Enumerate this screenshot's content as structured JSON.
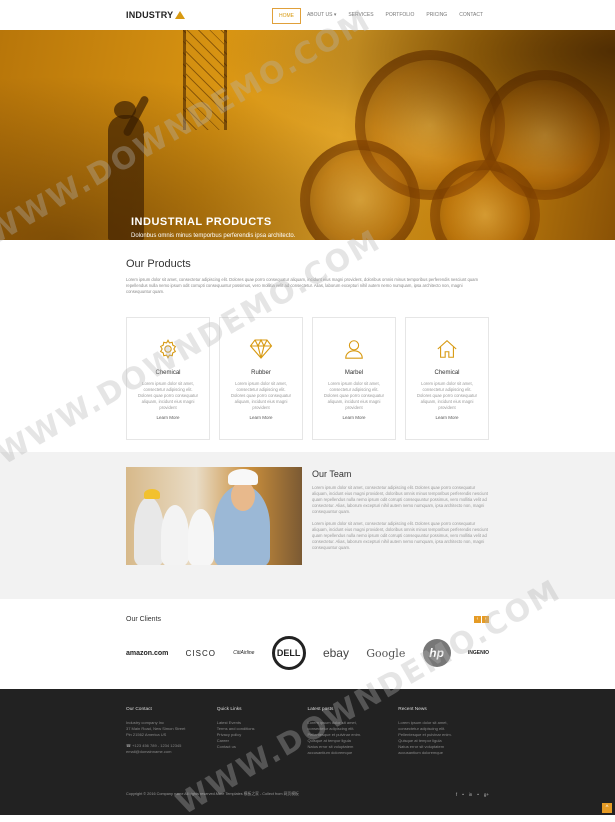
{
  "header": {
    "logo": "INDUSTRY",
    "nav": [
      {
        "label": "HOME",
        "active": true
      },
      {
        "label": "ABOUT US ▾",
        "active": false
      },
      {
        "label": "SERVICES",
        "active": false
      },
      {
        "label": "PORTFOLIO",
        "active": false
      },
      {
        "label": "PRICING",
        "active": false
      },
      {
        "label": "CONTACT",
        "active": false
      }
    ]
  },
  "hero": {
    "title": "INDUSTRIAL PRODUCTS",
    "subtitle": "Dolonbus omnis minus temporbus perferendis ipsa architecto."
  },
  "products": {
    "title": "Our Products",
    "lead": "Lorem ipsum dolor sit amet, consectetur adipiscing elit. Dolores quae porro consequatur aliquam, incidunt eius magni provident, doloribus omnis minus temporibus perferendis nesciunt quam repellendus nulla nemo ipsum odit corrupti consequuntur possimus, vero mollitia velit ad consectetur. Alias, laborum excepturi nihil autem nemo numquam, ipsa architecto non, magni consequuntur quam.",
    "cards": [
      {
        "icon": "gear-icon",
        "title": "Chemical",
        "text": "Lorem ipsum dolor sit amet, consectetur adipiscing elit. Dolores quae porro consequatur aliquam, incidunt eius magni provident",
        "link": "Learn More"
      },
      {
        "icon": "diamond-icon",
        "title": "Rubber",
        "text": "Lorem ipsum dolor sit amet, consectetur adipiscing elit. Dolores quae porro consequatur aliquam, incidunt eius magni provident",
        "link": "Learn More"
      },
      {
        "icon": "user-icon",
        "title": "Marbel",
        "text": "Lorem ipsum dolor sit amet, consectetur adipiscing elit. Dolores quae porro consequatur aliquam, incidunt eius magni provident",
        "link": "Learn More"
      },
      {
        "icon": "home-icon",
        "title": "Chemical",
        "text": "Lorem ipsum dolor sit amet, consectetur adipiscing elit. Dolores quae porro consequatur aliquam, incidunt eius magni provident",
        "link": "Learn More"
      }
    ]
  },
  "team": {
    "title": "Our Team",
    "p1": "Lorem ipsum dolor sit amet, consectetur adipiscing elit. Dolores quae porro consequatur aliquam, incidunt eius magni provident, doloribus omnis minus temporibus perferendis nesciunt quam repellendus nulla nemo ipsum odit corrupti consequuntur possimus, vero mollitia velit ad consectetur. Alias, laborum excepturi nihil autem nemo numquam, ipsa architecto non, magni consequuntur quam.",
    "p2": "Lorem ipsum dolor sit amet, consectetur adipiscing elit. Dolores quae porro consequatur aliquam, incidunt eius magni provident, doloribus omnis minus temporibus perferendis nesciunt quam repellendus nulla nemo ipsum odit corrupti consequuntur possimus, vero mollitia velit ad consectetur. Alias, laborum excepturi nihil autem nemo numquam, ipsa architecto non, magni consequuntur quam."
  },
  "clients": {
    "title": "Our Clients",
    "logos": [
      "amazon.com",
      "CISCO",
      "CitiAirline",
      "DELL",
      "ebay",
      "Google",
      "hp",
      "INGENIO"
    ]
  },
  "footer": {
    "contact": {
      "heading": "Our Contact",
      "lines": [
        "Industry company Inc",
        "37 Main Road, New Simon Street",
        "Pin 21562 America US",
        "",
        "☎ +123 456 789 - 1234 12345",
        "email@domainname.com"
      ]
    },
    "quick_links": {
      "heading": "Quick Links",
      "items": [
        "Latest Events",
        "Terms and conditions",
        "Privacy policy",
        "Career",
        "Contact us"
      ]
    },
    "latest_posts": {
      "heading": "Latest posts",
      "items": [
        "Lorem ipsum dolor sit amet,",
        "consectetur adipiscing elit.",
        "Pellentesque et pulvinar enim.",
        "Quisque at tempor ligula",
        "Natus error sit voluptatem",
        "accusantium doloremque"
      ]
    },
    "recent_news": {
      "heading": "Recent News",
      "items": [
        "Lorem ipsum dolor sit amet,",
        "consectetur adipiscing elit.",
        "Pellentesque et pulvinar enim.",
        "Quisque at tempor ligula",
        "Natus error sit voluptatem",
        "accusantium doloremque"
      ]
    },
    "copyright": "Copyright © 2016 Company name All rights reserved.More Templates 模板之家 - Collect from 网页模板",
    "social": [
      "f",
      "•",
      "in",
      "•",
      "g+"
    ]
  },
  "watermark": "WWW.DOWNDEMO.COM",
  "colors": {
    "accent": "#e59b25",
    "dark": "#222222",
    "light_bg": "#f2f2f2"
  }
}
